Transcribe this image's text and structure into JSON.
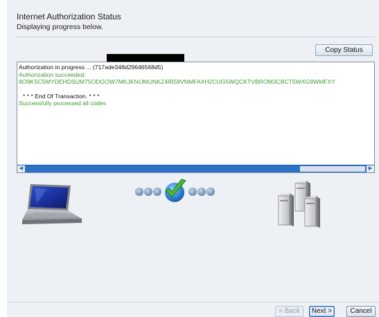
{
  "header": {
    "title": "Internet Authorization Status",
    "subtitle": "Displaying progress below."
  },
  "toolbar": {
    "copy_status_label": "Copy Status"
  },
  "log": {
    "lines": [
      "Authorization in progress ... (717ade348d29646568d5)",
      "Authorization succeeded:",
      "8O9KSC5MYDEHDSUM75ODGOW7MKJKNIJMUNKZ4IR59VNMFAXH2CUG5WQCKTVBROM3CBCT5WXG9WMFXY",
      "* * * End Of Transaction. * * *",
      "Successfully processed all codes"
    ],
    "colors": {
      "normal": "#111111",
      "success": "#3a9a2e"
    }
  },
  "graphics": {
    "left_icon": "laptop-icon",
    "center_icon": "progress-checkmark-icon",
    "right_icon": "servers-icon"
  },
  "footer": {
    "back_label": "< Back",
    "next_label": "Next >",
    "cancel_label": "Cancel"
  }
}
